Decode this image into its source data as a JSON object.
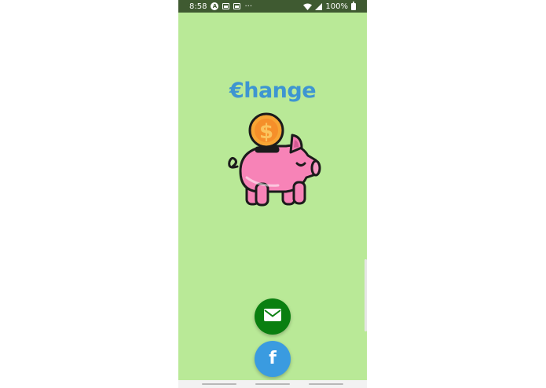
{
  "status_bar": {
    "time": "8:58",
    "notification_icons": [
      "a-badge-icon",
      "photo-icon",
      "image-icon"
    ],
    "more_label": "···",
    "battery": "100%"
  },
  "app": {
    "title": "€hange",
    "illustration": "piggy-bank-with-dollar-coin-icon"
  },
  "actions": {
    "email_icon": "envelope-icon",
    "facebook_icon": "facebook-icon",
    "facebook_glyph": "f"
  },
  "colors": {
    "background": "#b9e997",
    "status_bar": "#3f5a31",
    "title": "#3e95d1",
    "email_button": "#0a7f10",
    "facebook_button": "#3a9be0",
    "pig": "#f783b7",
    "coin": "#f7a534"
  }
}
